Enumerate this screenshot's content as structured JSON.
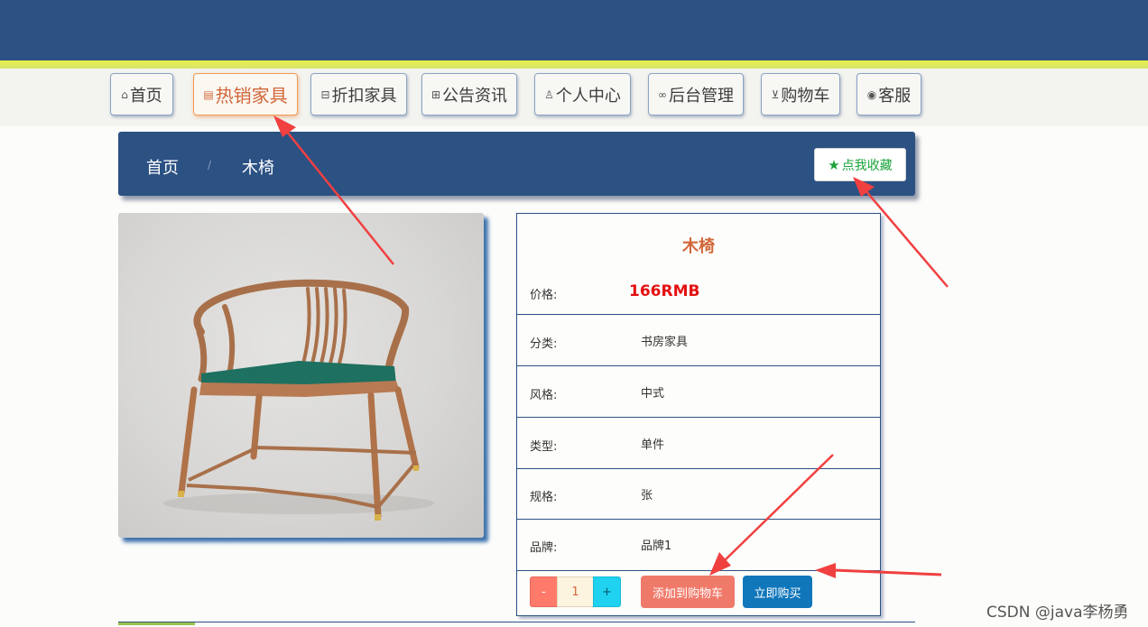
{
  "nav": {
    "items": [
      {
        "label": "首页",
        "icon": "home-icon",
        "glyph": "⌂"
      },
      {
        "label": "热销家具",
        "icon": "document-icon",
        "glyph": "▤"
      },
      {
        "label": "折扣家具",
        "icon": "print-icon",
        "glyph": "⊟"
      },
      {
        "label": "公告资讯",
        "icon": "grid-icon",
        "glyph": "⊞"
      },
      {
        "label": "个人中心",
        "icon": "user-icon",
        "glyph": "♙"
      },
      {
        "label": "后台管理",
        "icon": "link-icon",
        "glyph": "∞"
      },
      {
        "label": "购物车",
        "icon": "cart-icon",
        "glyph": "⊻"
      },
      {
        "label": "客服",
        "icon": "chat-icon",
        "glyph": "◉"
      }
    ],
    "active_index": 1
  },
  "breadcrumb": {
    "home": "首页",
    "separator": "/",
    "current": "木椅"
  },
  "favorite": {
    "icon": "star-icon",
    "glyph": "★",
    "label": "点我收藏"
  },
  "product": {
    "image_alt": "wooden-chair-photo",
    "name": "木椅",
    "price_label": "价格:",
    "price": "166RMB",
    "rows": [
      {
        "label": "分类:",
        "value": "书房家具"
      },
      {
        "label": "风格:",
        "value": "中式"
      },
      {
        "label": "类型:",
        "value": "单件"
      },
      {
        "label": "规格:",
        "value": "张"
      },
      {
        "label": "品牌:",
        "value": "品牌1"
      }
    ]
  },
  "purchase": {
    "minus": "-",
    "quantity": "1",
    "plus": "+",
    "add_to_cart": "添加到购物车",
    "buy_now": "立即购买"
  },
  "colors": {
    "header": "#2c5183",
    "accent_orange": "#d2673a",
    "price_red": "#e41010",
    "favorite_green": "#1aa33a",
    "cart_button": "#f07a6a",
    "buy_button": "#1177bb",
    "annotation_arrow": "#f04040"
  },
  "watermark": "CSDN @java李杨勇"
}
